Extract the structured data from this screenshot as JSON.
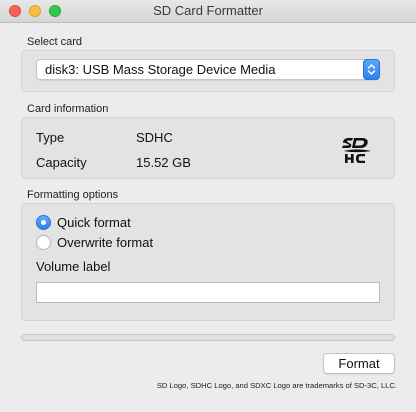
{
  "window": {
    "title": "SD Card Formatter"
  },
  "select_card": {
    "label": "Select card",
    "selected": "disk3: USB Mass Storage Device Media"
  },
  "card_info": {
    "label": "Card information",
    "type_label": "Type",
    "type_value": "SDHC",
    "capacity_label": "Capacity",
    "capacity_value": "15.52 GB",
    "logo_icon": "sdhc-logo-icon"
  },
  "formatting": {
    "label": "Formatting options",
    "options": [
      {
        "label": "Quick format",
        "selected": true
      },
      {
        "label": "Overwrite format",
        "selected": false
      }
    ],
    "volume_label": "Volume label",
    "volume_value": ""
  },
  "progress": {
    "fraction": 0
  },
  "actions": {
    "format_label": "Format"
  },
  "footer": {
    "note": "SD Logo, SDHC Logo, and SDXC Logo are trademarks of SD-3C, LLC."
  },
  "colors": {
    "accent": "#2f80ea",
    "close": "#fc605b",
    "minimize": "#fdbc40",
    "maximize": "#34c84a"
  }
}
